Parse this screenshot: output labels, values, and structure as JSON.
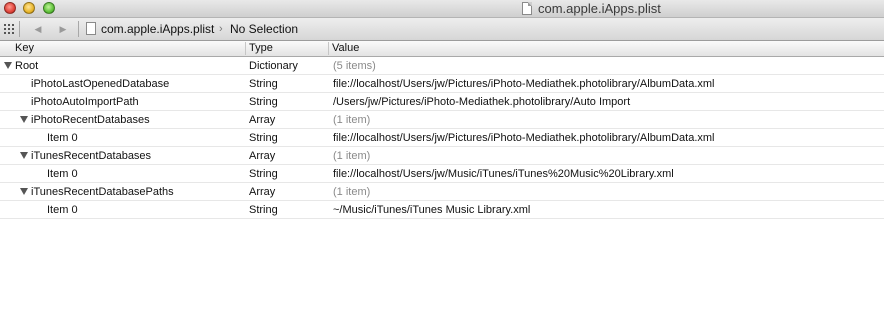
{
  "window": {
    "title": "com.apple.iApps.plist"
  },
  "toolbar": {
    "back_icon": "◀",
    "forward_icon": "▶",
    "path_file": "com.apple.iApps.plist",
    "path_separator": "›",
    "path_selection": "No Selection"
  },
  "columns": {
    "key": "Key",
    "type": "Type",
    "value": "Value"
  },
  "rows": [
    {
      "key": "Root",
      "type": "Dictionary",
      "value": "(5 items)"
    },
    {
      "key": "iPhotoLastOpenedDatabase",
      "type": "String",
      "value": "file://localhost/Users/jw/Pictures/iPhoto-Mediathek.photolibrary/AlbumData.xml"
    },
    {
      "key": "iPhotoAutoImportPath",
      "type": "String",
      "value": "/Users/jw/Pictures/iPhoto-Mediathek.photolibrary/Auto Import"
    },
    {
      "key": "iPhotoRecentDatabases",
      "type": "Array",
      "value": "(1 item)"
    },
    {
      "key": "Item 0",
      "type": "String",
      "value": "file://localhost/Users/jw/Pictures/iPhoto-Mediathek.photolibrary/AlbumData.xml"
    },
    {
      "key": "iTunesRecentDatabases",
      "type": "Array",
      "value": "(1 item)"
    },
    {
      "key": "Item 0",
      "type": "String",
      "value": "file://localhost/Users/jw/Music/iTunes/iTunes%20Music%20Library.xml"
    },
    {
      "key": "iTunesRecentDatabasePaths",
      "type": "Array",
      "value": "(1 item)"
    },
    {
      "key": "Item 0",
      "type": "String",
      "value": "~/Music/iTunes/iTunes Music Library.xml"
    }
  ]
}
